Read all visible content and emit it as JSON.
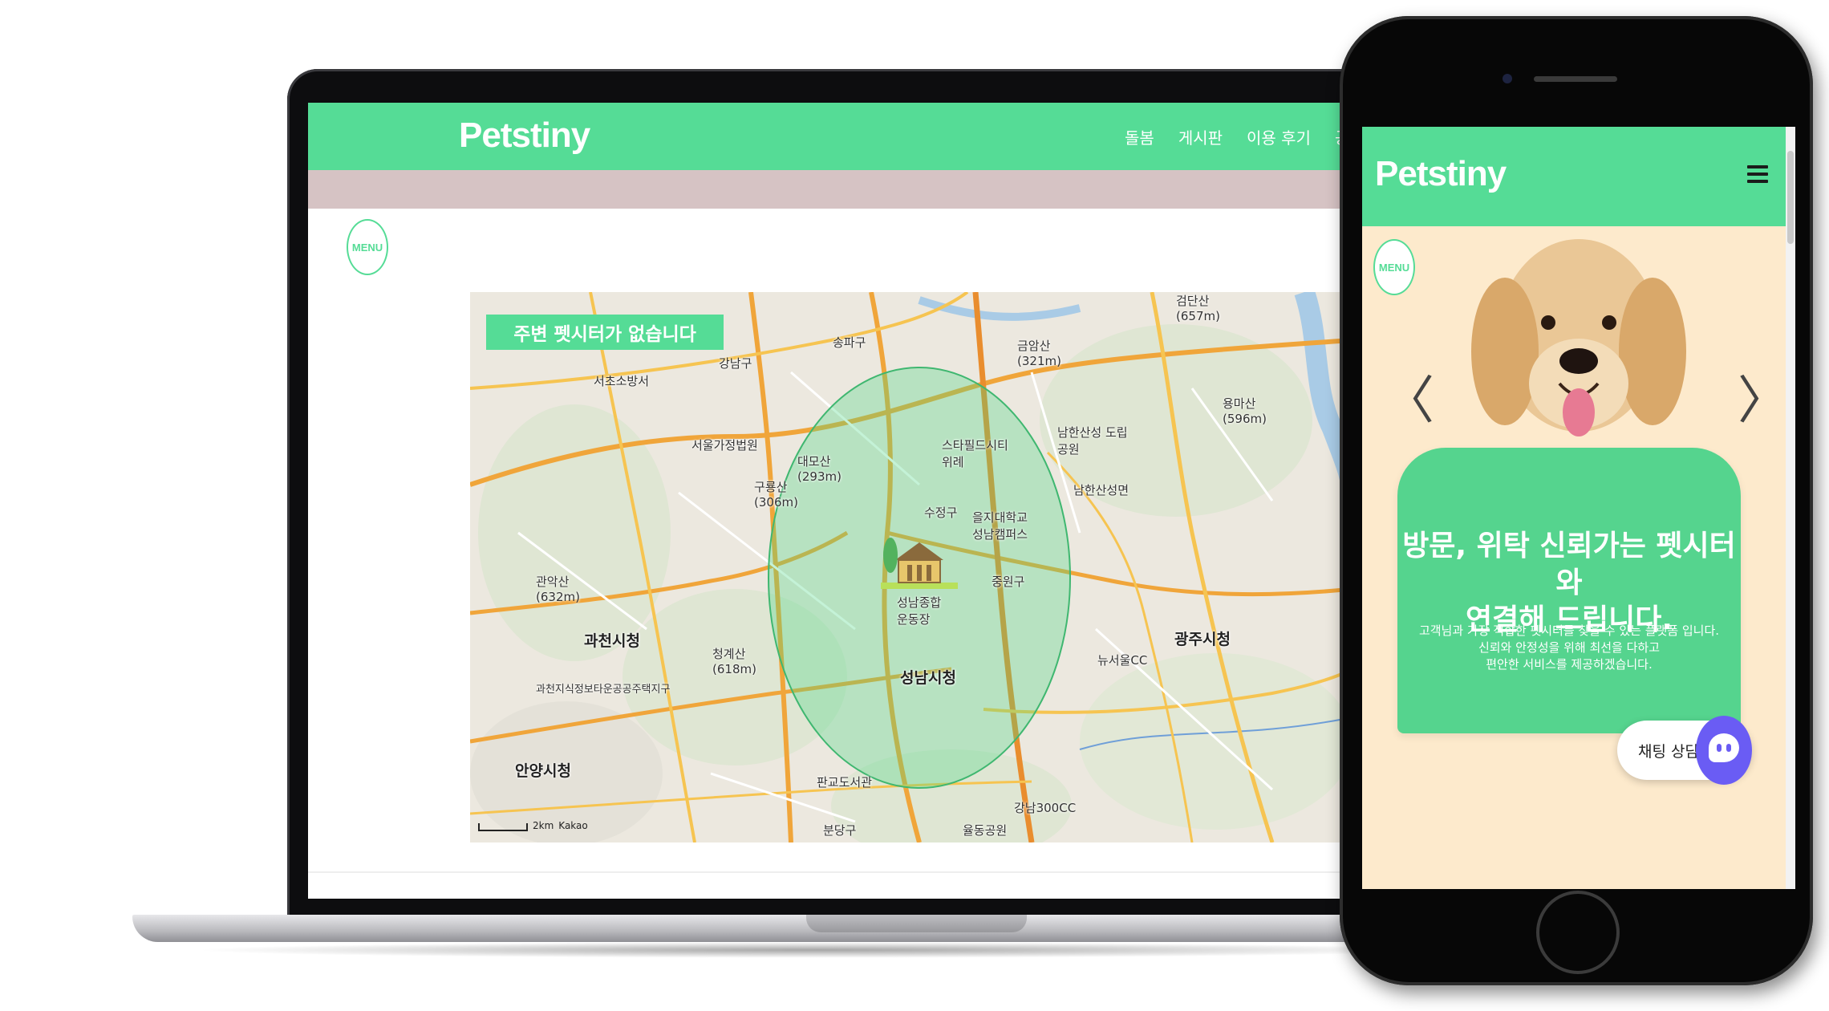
{
  "laptop": {
    "header": {
      "logo": "Petstiny",
      "nav": [
        "돌봄",
        "게시판",
        "이용 후기",
        "공지사"
      ]
    },
    "menu_button": "MENU",
    "map": {
      "banner": "주변 펫시터가 없습니다",
      "scale": "2km",
      "provider": "Kakao",
      "labels": {
        "district1": "강남구",
        "district2": "송파구",
        "district3": "수정구",
        "district4": "중원구",
        "city1": "과천시청",
        "city2": "성남시청",
        "city3": "광주시청",
        "city4": "안양시청",
        "place1": "스타필드시티 위례",
        "place2": "남한산성 도립공원",
        "place3": "서울가정법원",
        "place4": "판교도서관",
        "place5": "성남종합 운동장",
        "place6": "뉴서울CC",
        "place7": "남한산성면",
        "place8": "관악산 (632m)",
        "place9": "청계산 (618m)",
        "place10": "구룡산 (306m)",
        "place11": "대모산 (293m)",
        "place12": "검단산 (657m)",
        "place13": "용마산 (596m)",
        "place14": "금암산 (321m)",
        "place15": "서초소방서",
        "place16": "을지대학교 성남캠퍼스",
        "place17": "과천지식정보타운공공주택지구",
        "place18": "분당구",
        "place19": "율동공원",
        "place20": "강남300CC"
      }
    }
  },
  "phone": {
    "header": {
      "logo": "Petstiny",
      "menu_icon": "hamburger-icon"
    },
    "menu_button": "MENU",
    "slider": {
      "prev": "〈",
      "next": "〉"
    },
    "card": {
      "title_line1": "방문, 위탁 신뢰가는 펫시터와",
      "title_line2": "연결해 드립니다.",
      "body_line1": "고객님과 가장 적합한 펫시터를 찾을 수 있는 플랫폼 입니다.",
      "body_line2": "신뢰와 안정성을 위해 최선을 다하고",
      "body_line3": "편안한 서비스를 제공하겠습니다."
    },
    "chat": {
      "label": "채팅 상담",
      "icon": "chat-bubble-icon"
    }
  },
  "colors": {
    "brand_green": "#55dc96",
    "band_pink": "#d6c3c4",
    "phone_bg": "#fdeacc",
    "chat_purple": "#6a5cf4"
  }
}
